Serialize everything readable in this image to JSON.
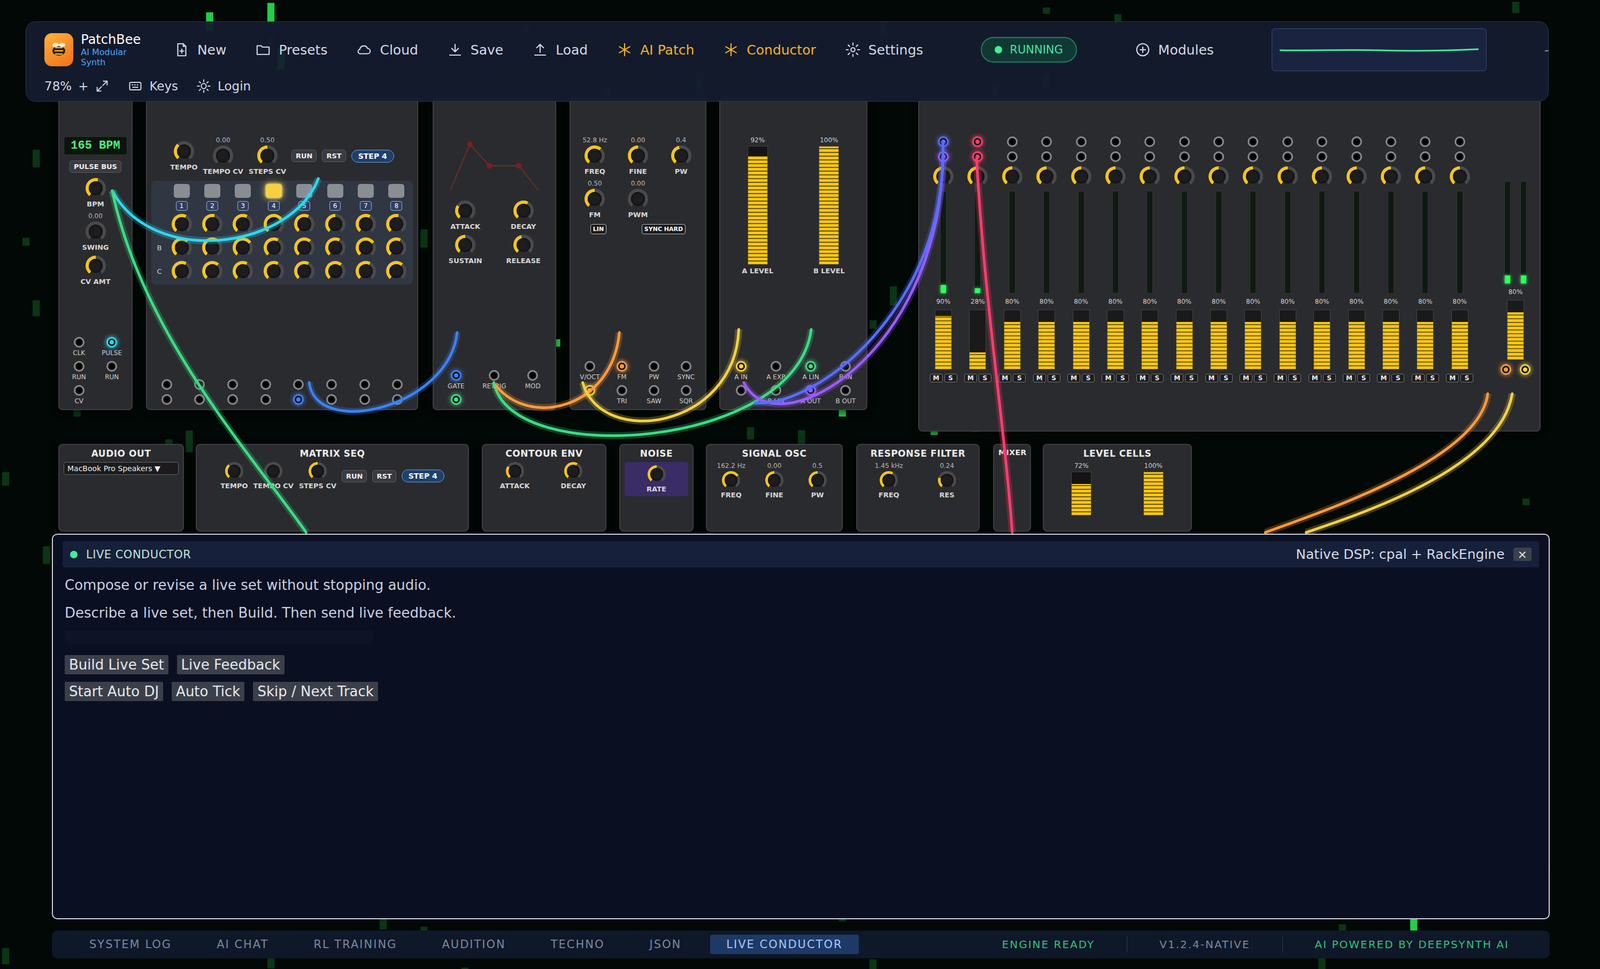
{
  "app": {
    "name": "PatchBee",
    "subtitle": "AI Modular Synth"
  },
  "toolbar": {
    "buttons": [
      {
        "label": "New",
        "kind": "plain"
      },
      {
        "label": "Presets",
        "kind": "plain"
      },
      {
        "label": "Cloud",
        "kind": "plain"
      },
      {
        "label": "Save",
        "kind": "plain"
      },
      {
        "label": "Load",
        "kind": "plain"
      },
      {
        "label": "AI Patch",
        "kind": "accent"
      },
      {
        "label": "Conductor",
        "kind": "accent"
      },
      {
        "label": "Settings",
        "kind": "plain"
      }
    ],
    "status": {
      "label": "RUNNING",
      "on": true
    },
    "modules_button": "Modules",
    "minimize": "-",
    "zoom": "78%",
    "zoom_in": "+",
    "keys": "Keys",
    "login": "Login"
  },
  "rack": {
    "modules": [
      {
        "kind": "clock",
        "display": "165 BPM",
        "buttons": [
          "PULSE BUS"
        ],
        "jacks": [
          {
            "label": "CLK",
            "connected": false
          },
          {
            "label": "PULSE",
            "connected": true,
            "color": "#2fd8f0"
          },
          {
            "label": "RUN",
            "connected": false
          },
          {
            "label": "RUN",
            "connected": false
          },
          {
            "label": "CV",
            "connected": false
          }
        ],
        "knobs": [
          {
            "label": "BPM",
            "level": 0.55
          },
          {
            "label": "SWING",
            "value": "0.00",
            "level": 0
          },
          {
            "label": "CV AMT",
            "level": 0.5
          }
        ]
      },
      {
        "kind": "sequencer",
        "knobs": [
          {
            "label": "TEMPO",
            "level": 0.35
          },
          {
            "label": "TEMPO CV",
            "value": "0.00",
            "level": 0
          },
          {
            "label": "STEPS CV",
            "value": "0.50",
            "level": 0.5
          }
        ],
        "buttons": [
          "RUN",
          "RST"
        ],
        "badge": "STEP 4",
        "steps": [
          {
            "label": "1",
            "selected": false
          },
          {
            "label": "2",
            "selected": false
          },
          {
            "label": "3",
            "selected": false
          },
          {
            "label": "4",
            "selected": true
          },
          {
            "label": "5",
            "selected": false
          },
          {
            "label": "6",
            "selected": false
          },
          {
            "label": "7",
            "selected": false
          },
          {
            "label": "8",
            "selected": false
          }
        ],
        "rows": [
          {
            "levels": [
              0.6,
              0.55,
              0.6,
              0.7,
              0.6,
              0.5,
              0.6,
              0.55
            ]
          },
          {
            "label": "B",
            "levels": [
              0.65,
              0.6,
              0.7,
              0.6,
              0.65,
              0.6,
              0.7,
              0.6
            ]
          },
          {
            "label": "C",
            "levels": [
              0.6,
              0.65,
              0.6,
              0.6,
              0.6,
              0.65,
              0.6,
              0.65
            ]
          }
        ],
        "jacks": [
          {
            "connected": false
          },
          {
            "connected": false
          },
          {
            "connected": false
          },
          {
            "connected": false
          },
          {
            "connected": false
          },
          {
            "connected": false
          },
          {
            "connected": false
          },
          {
            "connected": false
          },
          {
            "connected": false
          },
          {
            "connected": false
          },
          {
            "connected": false
          },
          {
            "connected": false
          },
          {
            "connected": true,
            "color": "#3b82f6"
          },
          {
            "connected": false
          },
          {
            "connected": false
          },
          {
            "connected": false
          }
        ]
      },
      {
        "kind": "envelope",
        "knobs": [
          {
            "label": "ATTACK",
            "level": 0.3
          },
          {
            "label": "DECAY",
            "level": 0.6
          },
          {
            "label": "SUSTAIN",
            "level": 0.5
          },
          {
            "label": "RELEASE",
            "level": 0.45
          }
        ],
        "jacks": [
          {
            "label": "GATE",
            "connected": true,
            "color": "#3b82f6"
          },
          {
            "label": "RETRIG",
            "connected": false
          },
          {
            "label": "MOD",
            "connected": false
          },
          {
            "connected": true,
            "color": "#3ddc84"
          }
        ]
      },
      {
        "kind": "oscillator",
        "knobs": [
          {
            "label": "FREQ",
            "value": "52.8 Hz",
            "level": 0.65
          },
          {
            "label": "FINE",
            "value": "0.00",
            "level": 0.5
          },
          {
            "label": "PW",
            "value": "0.4",
            "level": 0.45
          },
          {
            "label": "FM",
            "value": "0.50",
            "level": 0.5
          },
          {
            "label": "PWM",
            "value": "0.00",
            "level": 0
          }
        ],
        "switches": [
          "LIN",
          "SYNC HARD"
        ],
        "jacks": [
          {
            "label": "V/OCT",
            "connected": false
          },
          {
            "label": "FM",
            "connected": true,
            "color": "#ff9a3c"
          },
          {
            "label": "PW",
            "connected": false
          },
          {
            "label": "SYNC",
            "connected": false
          },
          {
            "connected": true,
            "color": "#f5d142"
          },
          {
            "label": "TRI",
            "connected": false
          },
          {
            "label": "SAW",
            "connected": false
          },
          {
            "label": "SQR",
            "connected": false
          }
        ]
      },
      {
        "kind": "levels",
        "meters": [
          {
            "label": "A LEVEL",
            "reading": "92%",
            "level": 0.92
          },
          {
            "label": "B LEVEL",
            "reading": "100%",
            "level": 1
          }
        ],
        "jacks": [
          {
            "label": "A IN",
            "connected": true,
            "color": "#f5d142"
          },
          {
            "label": "A EXP",
            "connected": false
          },
          {
            "label": "A LIN",
            "connected": true,
            "color": "#3ddc84"
          },
          {
            "label": "B IN",
            "connected": false
          },
          {
            "connected": false
          },
          {
            "label": "B LIN",
            "connected": false
          },
          {
            "label": "A OUT",
            "connected": true,
            "color": "#9b5cff"
          },
          {
            "label": "B OUT",
            "connected": false
          }
        ]
      },
      {
        "kind": "mixer",
        "mute_label": "M",
        "solo_label": "S",
        "channels": [
          {
            "jacks": [
              {
                "connected": true,
                "color": "#5a6cff"
              },
              {
                "connected": true,
                "color": "#9b5cff"
              }
            ],
            "pan": 0.5,
            "meter": 0.08,
            "reading": "90%",
            "level": 0.9,
            "muted": false,
            "soloed": false
          },
          {
            "jacks": [
              {
                "connected": true,
                "color": "#ff3d6e"
              },
              {
                "connected": true,
                "color": "#ff3d6e"
              }
            ],
            "pan": 0.5,
            "meter": 0.05,
            "reading": "28%",
            "level": 0.28,
            "muted": false,
            "soloed": false
          },
          {
            "jacks": [
              {
                "connected": false
              },
              {
                "connected": false
              }
            ],
            "pan": 0.5,
            "meter": 0,
            "reading": "80%",
            "level": 0.8,
            "muted": false,
            "soloed": false
          },
          {
            "jacks": [
              {
                "connected": false
              },
              {
                "connected": false
              }
            ],
            "pan": 0.5,
            "meter": 0,
            "reading": "80%",
            "level": 0.8,
            "muted": false,
            "soloed": false
          },
          {
            "jacks": [
              {
                "connected": false
              },
              {
                "connected": false
              }
            ],
            "pan": 0.5,
            "meter": 0,
            "reading": "80%",
            "level": 0.8,
            "muted": false,
            "soloed": false
          },
          {
            "jacks": [
              {
                "connected": false
              },
              {
                "connected": false
              }
            ],
            "pan": 0.5,
            "meter": 0,
            "reading": "80%",
            "level": 0.8,
            "muted": false,
            "soloed": false
          },
          {
            "jacks": [
              {
                "connected": false
              },
              {
                "connected": false
              }
            ],
            "pan": 0.5,
            "meter": 0,
            "reading": "80%",
            "level": 0.8,
            "muted": false,
            "soloed": false
          },
          {
            "jacks": [
              {
                "connected": false
              },
              {
                "connected": false
              }
            ],
            "pan": 0.5,
            "meter": 0,
            "reading": "80%",
            "level": 0.8,
            "muted": false,
            "soloed": false
          },
          {
            "jacks": [
              {
                "connected": false
              },
              {
                "connected": false
              }
            ],
            "pan": 0.5,
            "meter": 0,
            "reading": "80%",
            "level": 0.8,
            "muted": false,
            "soloed": false
          },
          {
            "jacks": [
              {
                "connected": false
              },
              {
                "connected": false
              }
            ],
            "pan": 0.5,
            "meter": 0,
            "reading": "80%",
            "level": 0.8,
            "muted": false,
            "soloed": false
          },
          {
            "jacks": [
              {
                "connected": false
              },
              {
                "connected": false
              }
            ],
            "pan": 0.5,
            "meter": 0,
            "reading": "80%",
            "level": 0.8,
            "muted": false,
            "soloed": false
          },
          {
            "jacks": [
              {
                "connected": false
              },
              {
                "connected": false
              }
            ],
            "pan": 0.5,
            "meter": 0,
            "reading": "80%",
            "level": 0.8,
            "muted": false,
            "soloed": false
          },
          {
            "jacks": [
              {
                "connected": false
              },
              {
                "connected": false
              }
            ],
            "pan": 0.5,
            "meter": 0,
            "reading": "80%",
            "level": 0.8,
            "muted": false,
            "soloed": false
          },
          {
            "jacks": [
              {
                "connected": false
              },
              {
                "connected": false
              }
            ],
            "pan": 0.5,
            "meter": 0,
            "reading": "80%",
            "level": 0.8,
            "muted": false,
            "soloed": false
          },
          {
            "jacks": [
              {
                "connected": false
              },
              {
                "connected": false
              }
            ],
            "pan": 0.5,
            "meter": 0,
            "reading": "80%",
            "level": 0.8,
            "muted": false,
            "soloed": false
          },
          {
            "jacks": [
              {
                "connected": false
              },
              {
                "connected": false
              }
            ],
            "pan": 0.5,
            "meter": 0,
            "reading": "80%",
            "level": 0.8,
            "muted": false,
            "soloed": false
          }
        ],
        "master": {
          "meters": [
            0.08,
            0.08
          ],
          "reading": "80%",
          "level": 0.8,
          "jacks": [
            {
              "connected": true,
              "color": "#ff9a3c"
            },
            {
              "connected": true,
              "color": "#f5d142"
            }
          ]
        }
      },
      {
        "kind": "audio",
        "title": "AUDIO OUT",
        "select": "MacBook Pro Speakers ▼"
      },
      {
        "kind": "sequencer",
        "title": "MATRIX SEQ",
        "knobs": [
          {
            "label": "TEMPO",
            "level": 0.35
          },
          {
            "label": "TEMPO CV",
            "level": 0
          },
          {
            "label": "STEPS CV",
            "level": 0.5
          }
        ],
        "buttons": [
          "RUN",
          "RST"
        ],
        "badge": "STEP 4"
      },
      {
        "kind": "envelope",
        "title": "CONTOUR ENV",
        "knobs": [
          {
            "label": "ATTACK",
            "level": 0.3
          },
          {
            "label": "DECAY",
            "level": 0.6
          }
        ]
      },
      {
        "kind": "noise",
        "title": "NOISE",
        "knobs": [
          {
            "label": "RATE",
            "level": 0.5
          }
        ]
      },
      {
        "kind": "oscillator",
        "title": "SIGNAL OSC",
        "knobs": [
          {
            "label": "FREQ",
            "value": "162.2 Hz",
            "level": 0.7
          },
          {
            "label": "FINE",
            "value": "0.00",
            "level": 0.5
          },
          {
            "label": "PW",
            "value": "0.5",
            "level": 0.5
          }
        ]
      },
      {
        "kind": "filter",
        "title": "RESPONSE FILTER",
        "knobs": [
          {
            "label": "FREQ",
            "value": "1.45 kHz",
            "level": 0.6
          },
          {
            "label": "RES",
            "value": "0.24",
            "level": 0.24
          }
        ]
      },
      {
        "kind": "mixsmall",
        "title": "MIXER"
      },
      {
        "kind": "levels",
        "title": "LEVEL CELLS",
        "meters": [
          {
            "reading": "72%",
            "level": 0.72
          },
          {
            "reading": "100%",
            "level": 1
          }
        ]
      }
    ]
  },
  "cables": [
    {
      "color": "#2fd8f0"
    },
    {
      "color": "#3ddc84"
    },
    {
      "color": "#3b82f6"
    },
    {
      "color": "#3ddc84"
    },
    {
      "color": "#ff9a3c"
    },
    {
      "color": "#f5d142"
    },
    {
      "color": "#9b5cff"
    },
    {
      "color": "#5a6cff"
    },
    {
      "color": "#ff3d6e"
    },
    {
      "color": "#ff9a3c"
    },
    {
      "color": "#f5d142"
    }
  ],
  "conductor": {
    "title": "LIVE CONDUCTOR",
    "live": true,
    "engine": "Native DSP: cpal + RackEngine",
    "close": "×",
    "lines": [
      "Compose or revise a live set without stopping audio.",
      "Describe a live set, then Build. Then send live feedback."
    ],
    "input": {
      "value": ""
    },
    "button_rows": [
      [
        "Build Live Set",
        "Live Feedback"
      ],
      [
        "Start Auto DJ",
        "Auto Tick",
        "Skip / Next Track"
      ]
    ]
  },
  "bottom_bar": {
    "tabs": [
      {
        "label": "SYSTEM LOG",
        "selected": false
      },
      {
        "label": "AI CHAT",
        "selected": false
      },
      {
        "label": "RL TRAINING",
        "selected": false
      },
      {
        "label": "AUDITION",
        "selected": false
      },
      {
        "label": "TECHNO",
        "selected": false
      },
      {
        "label": "JSON",
        "selected": false
      },
      {
        "label": "LIVE CONDUCTOR",
        "selected": true
      }
    ],
    "status": [
      {
        "label": "ENGINE READY",
        "color": "#35c27a"
      },
      {
        "label": "V1.2.4-NATIVE",
        "color": "#7d889e"
      },
      {
        "label": "AI POWERED BY DEEPSYNTH AI",
        "color": "#35c27a"
      }
    ]
  }
}
